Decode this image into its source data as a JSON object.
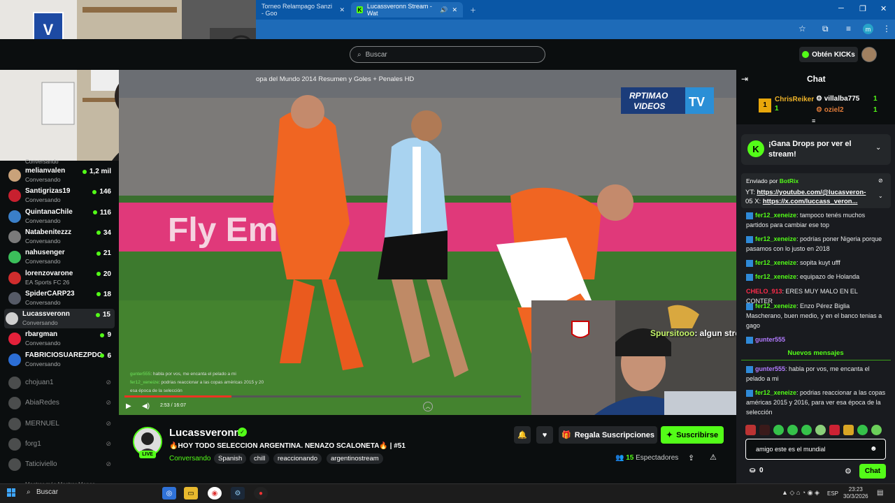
{
  "browser": {
    "tabs": [
      {
        "label": "Torneo Relampago Sanzi - Goo"
      },
      {
        "label": "Lucassveronn Stream - Wat"
      }
    ],
    "profile_letter": "m"
  },
  "header": {
    "search_placeholder": "Buscar",
    "kicks_button": "Obtén KICKs"
  },
  "sidebar": {
    "cut_top_sub": "Conversando",
    "live": [
      {
        "name": "melianvalen",
        "sub": "Conversando",
        "count": "1,2 mil",
        "color": "#c9a27a"
      },
      {
        "name": "Santigrizas19",
        "sub": "Conversando",
        "count": "146",
        "color": "#c8202f"
      },
      {
        "name": "QuintanaChile",
        "sub": "Conversando",
        "count": "116",
        "color": "#3a7fc8"
      },
      {
        "name": "Natabenitezzz",
        "sub": "Conversando",
        "count": "34",
        "color": "#7a7a7a"
      },
      {
        "name": "nahusenger",
        "sub": "Conversando",
        "count": "21",
        "color": "#3bbf5a"
      },
      {
        "name": "lorenzovarone",
        "sub": "EA Sports FC 26",
        "count": "20",
        "color": "#d02d2d"
      },
      {
        "name": "SpiderCARP23",
        "sub": "Conversando",
        "count": "18",
        "color": "#555a66"
      },
      {
        "name": "Lucassveronn",
        "sub": "Conversando",
        "count": "15",
        "color": "#cfcfcf"
      },
      {
        "name": "rbargman",
        "sub": "Conversando",
        "count": "9",
        "color": "#e3213a"
      },
      {
        "name": "FABRICIOSUAREZPDC",
        "sub": "Conversando",
        "count": "6",
        "color": "#2c6ed5"
      }
    ],
    "offline": [
      {
        "name": "chojuan1"
      },
      {
        "name": "AbiaRedes"
      },
      {
        "name": "MERNUEL"
      },
      {
        "name": "forg1"
      },
      {
        "name": "Taticiviello"
      }
    ],
    "more": "Mostrar más       Mostrar Menos"
  },
  "video": {
    "title": "opa del Mundo 2014 Resumen y Goles + Penales HD",
    "watermark_line1": "RPTIMAO",
    "watermark_line2": "VIDEOS",
    "watermark_tv": "TV",
    "banner_text": "Fly Emir",
    "overlay_user": "Spursitooo",
    "overlay_text": ": algun streamer es de el tottenham?",
    "small_chat": [
      {
        "user": "gunter555",
        "text": ": habla por vos, me encanta el pelado a mi"
      },
      {
        "user": "fer12_xeneize",
        "text": ": podrias reaccionar a las copas américas 2015 y 20"
      },
      {
        "user": "",
        "text": "esa época de la selección"
      }
    ],
    "time": "2:53 / 16:07",
    "progress": 0.27
  },
  "stream": {
    "name": "Lucassveronn",
    "title": "🔥HOY TODO SELECCION ARGENTINA. NENAZO SCALONETA🔥 | #51",
    "category": "Conversando",
    "tags": [
      "Spanish",
      "chill",
      "reaccionando",
      "argentinostream"
    ],
    "live_label": "LIVE",
    "gift_label": "Regala Suscripciones",
    "subscribe_label": "Suscribirse",
    "viewers_count": "15",
    "viewers_label": "Espectadores"
  },
  "chat": {
    "title": "Chat",
    "leaderboard": {
      "first": {
        "rank": "1",
        "name": "ChrisReiker",
        "count": "1"
      },
      "second": {
        "name": "villalba775",
        "count": "1"
      },
      "third": {
        "name": "oziel2",
        "count": "1"
      }
    },
    "drops_text": "¡Gana Drops por ver el stream!",
    "pinned": {
      "sent_by": "Enviado por",
      "bot": "BotRix",
      "line1_prefix": "YT: ",
      "line1_link": "https://youtube.com/@lucasveron-",
      "line2_prefix": "05 X: ",
      "line2_link": "https://x.com/luccass_veron..."
    },
    "messages": [
      {
        "user": "fer12_xeneize",
        "text": ": tampoco tenés muchos partidos para cambiar ese top"
      },
      {
        "user": "fer12_xeneize",
        "text": ": podrías poner Nigeria porque pasamos con lo justo en 2018"
      },
      {
        "user": "fer12_xeneize",
        "text": ": sopita kuyt ufff"
      },
      {
        "user": "fer12_xeneize",
        "text": ": equipazo de Holanda"
      },
      {
        "user": "CHELO_913",
        "text": ": ERES MUY MALO EN EL CONTER"
      },
      {
        "user": "fer12_xeneize",
        "text": ": Enzo Pérez Biglia Mascherano, buen medio, y en el banco tenias a gago"
      },
      {
        "user": "gunter555",
        "text": ""
      }
    ],
    "new_messages_label": "Nuevos mensajes",
    "new_messages": [
      {
        "user": "gunter555",
        "text": ": habla por vos, me encanta el pelado a mi"
      },
      {
        "user": "fer12_xeneize",
        "text": ": podrias reaccionar a las copas américas 2015 y 2016, para ver esa época de la selección"
      }
    ],
    "input_value": "amigo este es el mundial",
    "kicks_count": "0",
    "send_label": "Chat"
  },
  "taskbar": {
    "search": "Buscar",
    "lang": "ESP",
    "time": "23:23",
    "date": "30/3/2026"
  }
}
